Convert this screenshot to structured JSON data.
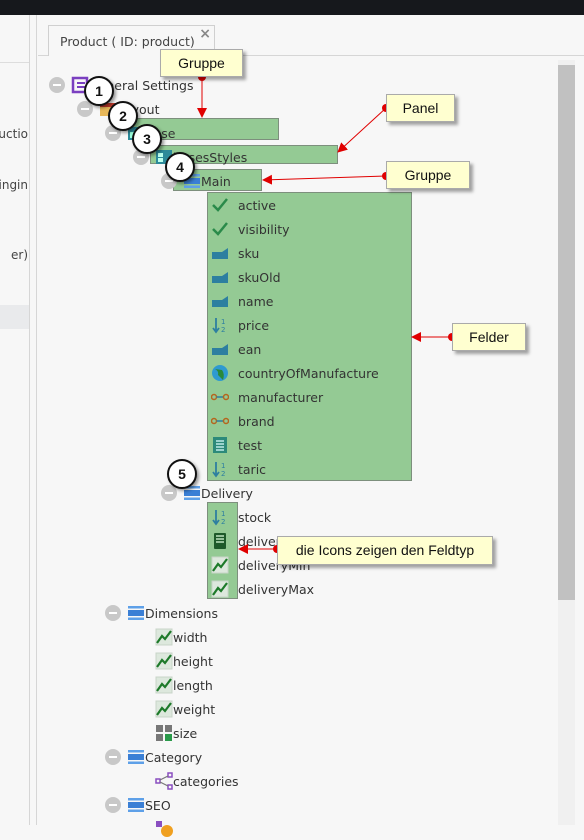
{
  "left_panel": {
    "fragments": [
      "uctio",
      "ingin",
      "er)"
    ]
  },
  "tab": {
    "title": "Product ( ID: product)",
    "close": "×"
  },
  "tree": [
    {
      "level": 0,
      "label": "General Settings",
      "icon": "form-icon",
      "collapse": true
    },
    {
      "level": 1,
      "label": "Layout",
      "icon": "layout-icon",
      "collapse": true
    },
    {
      "level": 2,
      "label": "Base",
      "icon": "tabpanel-icon",
      "collapse": true
    },
    {
      "level": 3,
      "label": "basesStyles",
      "icon": "panel-icon",
      "collapse": true
    },
    {
      "level": 4,
      "label": "Main",
      "icon": "fieldset-icon",
      "collapse": true
    },
    {
      "level": 5,
      "label": "active",
      "icon": "checkbox-icon"
    },
    {
      "level": 5,
      "label": "visibility",
      "icon": "checkbox-icon"
    },
    {
      "level": 5,
      "label": "sku",
      "icon": "input-icon"
    },
    {
      "level": 5,
      "label": "skuOld",
      "icon": "input-icon"
    },
    {
      "level": 5,
      "label": "name",
      "icon": "input-icon"
    },
    {
      "level": 5,
      "label": "price",
      "icon": "numeric-icon"
    },
    {
      "level": 5,
      "label": "ean",
      "icon": "input-icon"
    },
    {
      "level": 5,
      "label": "countryOfManufacture",
      "icon": "globe-icon"
    },
    {
      "level": 5,
      "label": "manufacturer",
      "icon": "relation-icon"
    },
    {
      "level": 5,
      "label": "brand",
      "icon": "relation-icon"
    },
    {
      "level": 5,
      "label": "test",
      "icon": "textarea-icon"
    },
    {
      "level": 5,
      "label": "taric",
      "icon": "numeric-icon"
    },
    {
      "level": 4,
      "label": "Delivery",
      "icon": "fieldset-icon",
      "collapse": true
    },
    {
      "level": 5,
      "label": "stock",
      "icon": "numeric-icon"
    },
    {
      "level": 5,
      "label": "delivery",
      "icon": "select-icon"
    },
    {
      "level": 5,
      "label": "deliveryMin",
      "icon": "quantity-icon"
    },
    {
      "level": 5,
      "label": "deliveryMax",
      "icon": "quantity-icon"
    },
    {
      "level": 2,
      "label": "Dimensions",
      "icon": "fieldset-icon",
      "collapse": true
    },
    {
      "level": 3,
      "label": "width",
      "icon": "quantity-icon"
    },
    {
      "level": 3,
      "label": "height",
      "icon": "quantity-icon"
    },
    {
      "level": 3,
      "label": "length",
      "icon": "quantity-icon"
    },
    {
      "level": 3,
      "label": "weight",
      "icon": "quantity-icon"
    },
    {
      "level": 3,
      "label": "size",
      "icon": "calculator-icon"
    },
    {
      "level": 2,
      "label": "Category",
      "icon": "fieldset-icon",
      "collapse": true
    },
    {
      "level": 3,
      "label": "categories",
      "icon": "many-to-many-icon"
    },
    {
      "level": 2,
      "label": "SEO",
      "icon": "fieldset-icon",
      "collapse": true
    },
    {
      "level": 3,
      "label": "",
      "icon": "localized-icon"
    }
  ],
  "annotations": {
    "callouts": [
      "Gruppe",
      "Panel",
      "Gruppe",
      "Felder",
      "die Icons zeigen den Feldtyp"
    ],
    "numbers": [
      "1",
      "2",
      "3",
      "4",
      "5"
    ]
  },
  "colors": {
    "highlight": "#6eb96e",
    "callout_bg": "#ffffd0",
    "arrow": "#e00000"
  }
}
